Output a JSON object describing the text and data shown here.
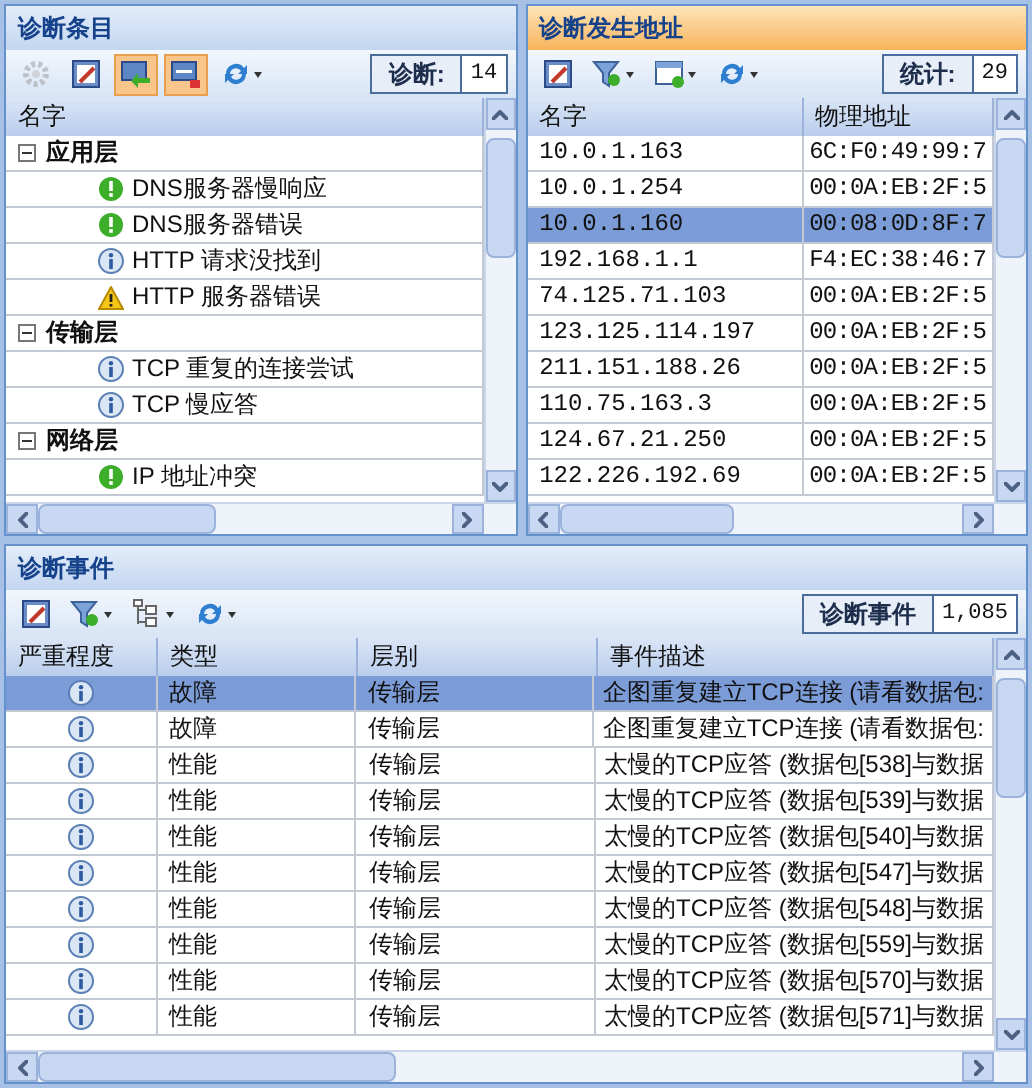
{
  "diagnosis_pane": {
    "title": "诊断条目",
    "active": false,
    "toolbar": [
      {
        "kind": "gear",
        "disabled": true,
        "pressed": false
      },
      {
        "kind": "report",
        "disabled": false,
        "pressed": false
      },
      {
        "kind": "import",
        "disabled": false,
        "pressed": true
      },
      {
        "kind": "export",
        "disabled": false,
        "pressed": true
      },
      {
        "kind": "refresh",
        "disabled": false,
        "pressed": false
      }
    ],
    "counter": {
      "label": "诊断:",
      "value": "14"
    },
    "columns": [
      "名字"
    ],
    "tree": [
      {
        "label": "应用层",
        "expanded": true,
        "children": [
          {
            "label": "DNS服务器慢响应",
            "kind": "ok"
          },
          {
            "label": "DNS服务器错误",
            "kind": "ok"
          },
          {
            "label": "HTTP 请求没找到",
            "kind": "info"
          },
          {
            "label": "HTTP 服务器错误",
            "kind": "warning"
          }
        ]
      },
      {
        "label": "传输层",
        "expanded": true,
        "children": [
          {
            "label": "TCP 重复的连接尝试",
            "kind": "info"
          },
          {
            "label": "TCP 慢应答",
            "kind": "info"
          }
        ]
      },
      {
        "label": "网络层",
        "expanded": true,
        "children": [
          {
            "label": "IP 地址冲突",
            "kind": "ok"
          }
        ]
      }
    ]
  },
  "address_pane": {
    "title": "诊断发生地址",
    "active": true,
    "toolbar": [
      {
        "kind": "report",
        "disabled": false,
        "pressed": false
      },
      {
        "kind": "filter",
        "disabled": false,
        "pressed": false
      },
      {
        "kind": "columns",
        "disabled": false,
        "pressed": false
      },
      {
        "kind": "refresh",
        "disabled": false,
        "pressed": false
      }
    ],
    "counter": {
      "label": "统计:",
      "value": "29"
    },
    "columns": [
      "名字",
      "物理地址"
    ],
    "rows": [
      {
        "name": "10.0.1.163",
        "mac": "6C:F0:49:99:7",
        "selected": false
      },
      {
        "name": "10.0.1.254",
        "mac": "00:0A:EB:2F:5",
        "selected": false
      },
      {
        "name": "10.0.1.160",
        "mac": "00:08:0D:8F:7",
        "selected": true
      },
      {
        "name": "192.168.1.1",
        "mac": "F4:EC:38:46:7",
        "selected": false
      },
      {
        "name": "74.125.71.103",
        "mac": "00:0A:EB:2F:5",
        "selected": false
      },
      {
        "name": "123.125.114.197",
        "mac": "00:0A:EB:2F:5",
        "selected": false
      },
      {
        "name": "211.151.188.26",
        "mac": "00:0A:EB:2F:5",
        "selected": false
      },
      {
        "name": "110.75.163.3",
        "mac": "00:0A:EB:2F:5",
        "selected": false
      },
      {
        "name": "124.67.21.250",
        "mac": "00:0A:EB:2F:5",
        "selected": false
      },
      {
        "name": "122.226.192.69",
        "mac": "00:0A:EB:2F:5",
        "selected": false
      }
    ]
  },
  "events_pane": {
    "title": "诊断事件",
    "active": false,
    "toolbar": [
      {
        "kind": "report",
        "disabled": false,
        "pressed": false
      },
      {
        "kind": "filter",
        "disabled": false,
        "pressed": false
      },
      {
        "kind": "tree",
        "disabled": false,
        "pressed": false
      },
      {
        "kind": "refresh",
        "disabled": false,
        "pressed": false
      }
    ],
    "counter": {
      "label": "诊断事件",
      "value": "1,085"
    },
    "columns": [
      "严重程度",
      "类型",
      "层别",
      "事件描述"
    ],
    "rows": [
      {
        "kind": "info",
        "type": "故障",
        "layer": "传输层",
        "description": "企图重复建立TCP连接 (请看数据包:",
        "selected": true
      },
      {
        "kind": "info",
        "type": "故障",
        "layer": "传输层",
        "description": "企图重复建立TCP连接 (请看数据包:",
        "selected": false
      },
      {
        "kind": "info",
        "type": "性能",
        "layer": "传输层",
        "description": "太慢的TCP应答 (数据包[538]与数据",
        "selected": false
      },
      {
        "kind": "info",
        "type": "性能",
        "layer": "传输层",
        "description": "太慢的TCP应答 (数据包[539]与数据",
        "selected": false
      },
      {
        "kind": "info",
        "type": "性能",
        "layer": "传输层",
        "description": "太慢的TCP应答 (数据包[540]与数据",
        "selected": false
      },
      {
        "kind": "info",
        "type": "性能",
        "layer": "传输层",
        "description": "太慢的TCP应答 (数据包[547]与数据",
        "selected": false
      },
      {
        "kind": "info",
        "type": "性能",
        "layer": "传输层",
        "description": "太慢的TCP应答 (数据包[548]与数据",
        "selected": false
      },
      {
        "kind": "info",
        "type": "性能",
        "layer": "传输层",
        "description": "太慢的TCP应答 (数据包[559]与数据",
        "selected": false
      },
      {
        "kind": "info",
        "type": "性能",
        "layer": "传输层",
        "description": "太慢的TCP应答 (数据包[570]与数据",
        "selected": false
      },
      {
        "kind": "info",
        "type": "性能",
        "layer": "传输层",
        "description": "太慢的TCP应答 (数据包[571]与数据",
        "selected": false
      }
    ]
  }
}
